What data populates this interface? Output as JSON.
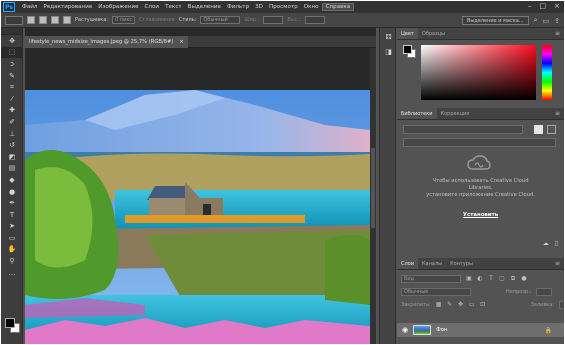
{
  "menubar": {
    "logo": "Ps",
    "items": [
      "Файл",
      "Редактирование",
      "Изображение",
      "Слои",
      "Текст",
      "Выделение",
      "Фильтр",
      "3D",
      "Просмотр",
      "Окно",
      "Справка"
    ],
    "controls": [
      "–",
      "□",
      "×"
    ]
  },
  "options": {
    "feather_label": "Растушевка:",
    "feather_value": "0 пикс",
    "antialias": "Сглаживание",
    "style_label": "Стиль:",
    "style_value": "Обычный",
    "width_label": "Шир.:",
    "height_label": "Выс.:",
    "select_mask": "Выделение и маска..."
  },
  "document": {
    "tab_title": "lifestyle_news_midsize_images.jpeg @ 25,7% (RGB/8#)",
    "close": "×"
  },
  "panels": {
    "color_tabs": [
      "Цвет",
      "Образцы"
    ],
    "library_tabs": [
      "Библиотеки",
      "Коррекция"
    ],
    "cc_message_line1": "Чтобы использовать Creative Cloud",
    "cc_message_line2": "Libraries,",
    "cc_message_line3": "установите приложение Creative Cloud.",
    "cc_install": "Установить",
    "layer_tabs": [
      "Слои",
      "Каналы",
      "Контуры"
    ],
    "search_kind": "Вид",
    "blend_mode": "Обычные",
    "opacity_label": "Непрозр.:",
    "lock_label": "Закрепить:",
    "fill_label": "Заливка:",
    "layer_name": "Фон",
    "lock_icon": "lock-icon"
  },
  "tools": [
    "move",
    "marquee",
    "lasso",
    "quick-select",
    "crop",
    "eyedropper",
    "healing",
    "brush",
    "stamp",
    "history",
    "eraser",
    "gradient",
    "blur",
    "dodge",
    "pen",
    "type",
    "path-select",
    "shape",
    "hand",
    "zoom",
    "more"
  ]
}
